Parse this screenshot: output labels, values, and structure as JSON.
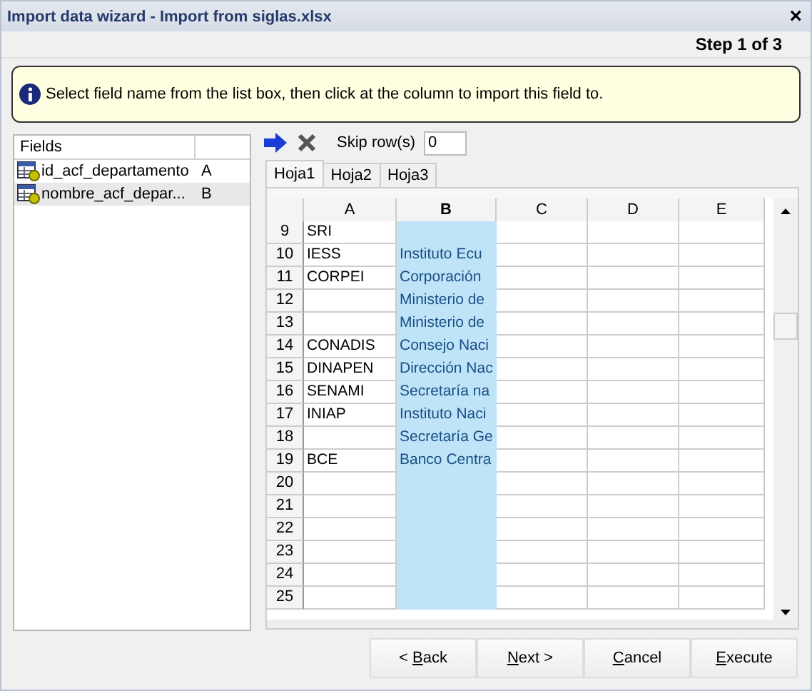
{
  "window": {
    "title": "Import data wizard - Import from siglas.xlsx",
    "close": "×"
  },
  "step": "Step 1 of 3",
  "info": "Select field name from the list box, then click at the column to import this field to.",
  "fields": {
    "header": "Fields",
    "items": [
      {
        "name": "id_acf_departamento",
        "column": "A",
        "selected": false
      },
      {
        "name": "nombre_acf_depar...",
        "column": "B",
        "selected": true
      }
    ]
  },
  "toolbar": {
    "skip_label": "Skip row(s)",
    "skip_value": "0"
  },
  "tabs": [
    {
      "label": "Hoja1",
      "selected": true
    },
    {
      "label": "Hoja2",
      "selected": false
    },
    {
      "label": "Hoja3",
      "selected": false
    }
  ],
  "grid": {
    "columns": [
      {
        "label": "A",
        "selected": false
      },
      {
        "label": "B",
        "selected": true
      },
      {
        "label": "C",
        "selected": false
      },
      {
        "label": "D",
        "selected": false
      },
      {
        "label": "E",
        "selected": false
      }
    ],
    "rows": [
      {
        "num": "9",
        "a": "SRI"
      },
      {
        "num": "10",
        "a": "IESS",
        "b": "Instituto Ecu"
      },
      {
        "num": "11",
        "a": "CORPEI",
        "b": "Corporación"
      },
      {
        "num": "12",
        "b": "Ministerio de"
      },
      {
        "num": "13",
        "b": "Ministerio de"
      },
      {
        "num": "14",
        "a": "CONADIS",
        "b": "Consejo Naci"
      },
      {
        "num": "15",
        "a": "DINAPEN",
        "b": "Dirección Nac"
      },
      {
        "num": "16",
        "a": "SENAMI",
        "b": "Secretaría na"
      },
      {
        "num": "17",
        "a": "INIAP",
        "b": "Instituto Naci"
      },
      {
        "num": "18",
        "b": "Secretaría Ge"
      },
      {
        "num": "19",
        "a": "BCE",
        "b": "Banco Centra"
      },
      {
        "num": "20"
      },
      {
        "num": "21"
      },
      {
        "num": "22"
      },
      {
        "num": "23"
      },
      {
        "num": "24"
      },
      {
        "num": "25"
      }
    ]
  },
  "buttons": [
    {
      "pre": "< ",
      "key": "B",
      "post": "ack"
    },
    {
      "key": "N",
      "post": "ext >"
    },
    {
      "key": "C",
      "post": "ancel"
    },
    {
      "key": "E",
      "post": "xecute"
    }
  ]
}
